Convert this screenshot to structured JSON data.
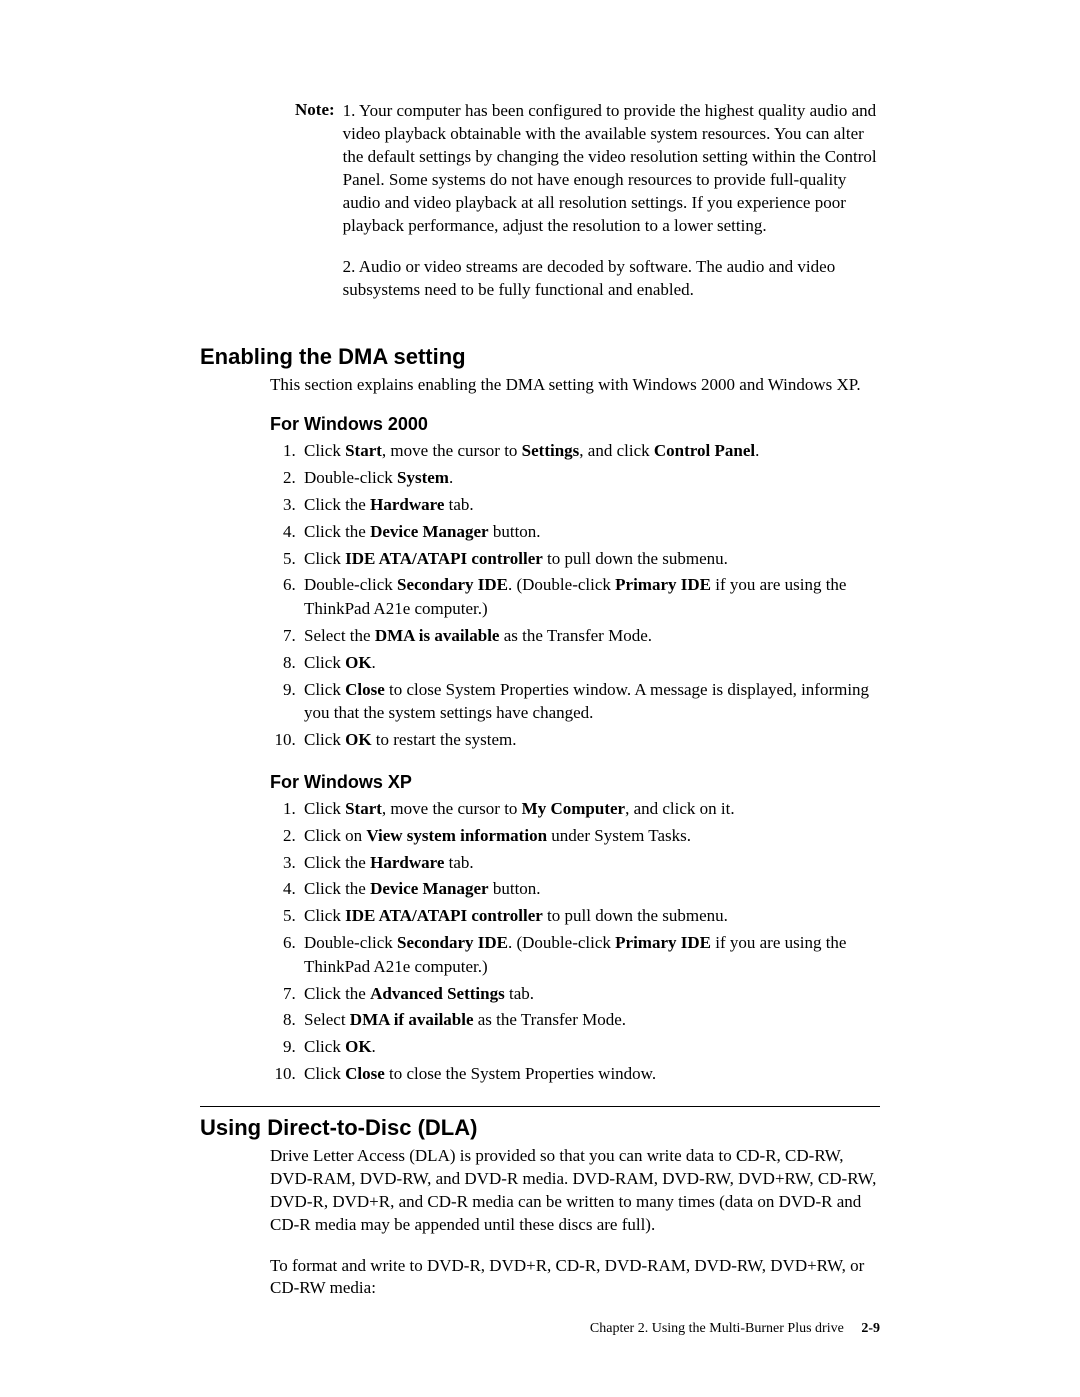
{
  "note": {
    "label": "Note:",
    "para1": "1. Your computer has been configured to provide the highest quality audio and video playback obtainable with the available system resources. You can alter the default settings by changing the video resolution setting within the Control Panel. Some systems do not have enough resources to provide full-quality audio and video playback at all resolution settings. If you experience poor playback performance, adjust the resolution to a lower setting.",
    "para2": "2. Audio or video streams are decoded by software. The audio and video subsystems need to be fully functional and enabled."
  },
  "sec1": {
    "heading": "Enabling the DMA setting",
    "intro": "This section explains enabling the DMA setting with Windows 2000 and Windows XP.",
    "sub1": "For Windows 2000",
    "steps1": {
      "s1a": "Click ",
      "s1b": "Start",
      "s1c": ", move the cursor to ",
      "s1d": "Settings",
      "s1e": ", and click ",
      "s1f": "Control Panel",
      "s1g": ".",
      "s2a": "Double-click ",
      "s2b": "System",
      "s2c": ".",
      "s3a": "Click the ",
      "s3b": "Hardware",
      "s3c": " tab.",
      "s4a": "Click the ",
      "s4b": "Device Manager",
      "s4c": " button.",
      "s5a": "Click ",
      "s5b": "IDE ATA/ATAPI controller",
      "s5c": " to pull down the submenu.",
      "s6a": "Double-click ",
      "s6b": "Secondary IDE",
      "s6c": ". (Double-click ",
      "s6d": "Primary IDE",
      "s6e": " if you are using the ThinkPad A21e computer.)",
      "s7a": "Select the ",
      "s7b": "DMA is available",
      "s7c": " as the Transfer Mode.",
      "s8a": "Click ",
      "s8b": "OK",
      "s8c": ".",
      "s9a": "Click ",
      "s9b": "Close",
      "s9c": " to close System Properties window. A message is displayed, informing you that the system settings have changed.",
      "s10a": "Click ",
      "s10b": "OK",
      "s10c": " to restart the system."
    },
    "sub2": "For Windows XP",
    "steps2": {
      "s1a": "Click ",
      "s1b": "Start",
      "s1c": ", move the cursor to ",
      "s1d": "My Computer",
      "s1e": ", and click on it.",
      "s2a": "Click on ",
      "s2b": "View system information",
      "s2c": " under System Tasks.",
      "s3a": "Click the ",
      "s3b": "Hardware",
      "s3c": " tab.",
      "s4a": "Click the ",
      "s4b": "Device Manager",
      "s4c": " button.",
      "s5a": "Click ",
      "s5b": "IDE ATA/ATAPI controller",
      "s5c": " to pull down the submenu.",
      "s6a": "Double-click ",
      "s6b": "Secondary IDE",
      "s6c": ". (Double-click ",
      "s6d": "Primary IDE",
      "s6e": " if you are using the ThinkPad A21e computer.)",
      "s7a": "Click the ",
      "s7b": "Advanced Settings",
      "s7c": " tab.",
      "s8a": "Select ",
      "s8b": "DMA if available",
      "s8c": " as the Transfer Mode.",
      "s9a": "Click ",
      "s9b": "OK",
      "s9c": ".",
      "s10a": "Click ",
      "s10b": "Close",
      "s10c": " to close the System Properties window."
    }
  },
  "sec2": {
    "heading": "Using Direct-to-Disc (DLA)",
    "para1": "Drive Letter Access (DLA) is provided so that you can write data to CD-R, CD-RW, DVD-RAM, DVD-RW, and DVD-R media. DVD-RAM, DVD-RW, DVD+RW, CD-RW, DVD-R, DVD+R, and CD-R media can be written to many times (data on DVD-R and CD-R media may be appended until these discs are full).",
    "para2": "To format and write to DVD-R, DVD+R, CD-R, DVD-RAM, DVD-RW, DVD+RW, or CD-RW media:"
  },
  "footer": {
    "chapter": "Chapter 2. Using the Multi-Burner Plus drive",
    "page": "2-9"
  }
}
